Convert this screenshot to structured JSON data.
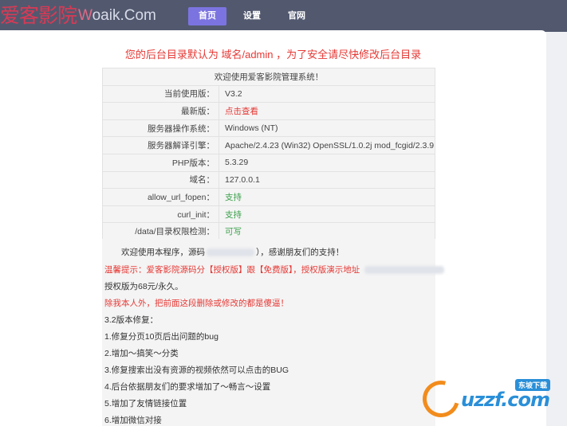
{
  "header": {
    "brand_cn": "爱客影院",
    "brand_en_w": "W",
    "brand_en_rest": "oaik.Com",
    "nav": [
      "首页",
      "设置",
      "官网"
    ],
    "active_nav": "首页"
  },
  "notice": "您的后台目录默认为 域名/admin ，为了安全请尽快修改后台目录",
  "table": {
    "heading": "欢迎使用爱客影院管理系统！",
    "rows": [
      {
        "key": "当前使用版：",
        "value": "V3.2",
        "color": "default"
      },
      {
        "key": "最新版：",
        "value": "点击查看",
        "color": "#e53935"
      },
      {
        "key": "服务器操作系统：",
        "value": "Windows (NT)",
        "color": "default"
      },
      {
        "key": "服务器解译引擎：",
        "value": "Apache/2.4.23 (Win32) OpenSSL/1.0.2j mod_fcgid/2.3.9",
        "color": "default"
      },
      {
        "key": "PHP版本：",
        "value": "5.3.29",
        "color": "default"
      },
      {
        "key": "域名：",
        "value": "127.0.0.1",
        "color": "default"
      },
      {
        "key": "allow_url_fopen：",
        "value": "支持",
        "color": "#3aa04a"
      },
      {
        "key": "curl_init：",
        "value": "支持",
        "color": "#3aa04a"
      },
      {
        "key": "/data/目录权限检测：",
        "value": "可写",
        "color": "#3aa04a"
      }
    ]
  },
  "description": {
    "thanks_before": "欢迎使用本程序，源码",
    "thanks_after": "），感谢朋友们的支持！",
    "tip": "温馨提示：爱客影院源码分【授权版】跟【免费版】，授权版演示地址",
    "price": "授权版为68元/永久。",
    "warning": "除我本人外，把前面这段删除或修改的都是傻逼！",
    "changelog_title": "3.2版本修复：",
    "changelog": [
      "1.修复分页10页后出问题的bug",
      "2.增加～搞笑～分类",
      "3.修复搜索出没有资源的视频依然可以点击的BUG",
      "4.后台依据朋友们的要求增加了～畅言～设置",
      "5.增加了友情链接位置",
      "6.增加微信对接"
    ]
  },
  "watermark": {
    "text": "uzzf.com",
    "badge": "东坡下载"
  },
  "colors": {
    "topbar": "#52596f",
    "nav_active": "#7b74e0",
    "brand_red": "#d83a55",
    "notice_red": "#e53935",
    "ok_green": "#3aa04a"
  }
}
